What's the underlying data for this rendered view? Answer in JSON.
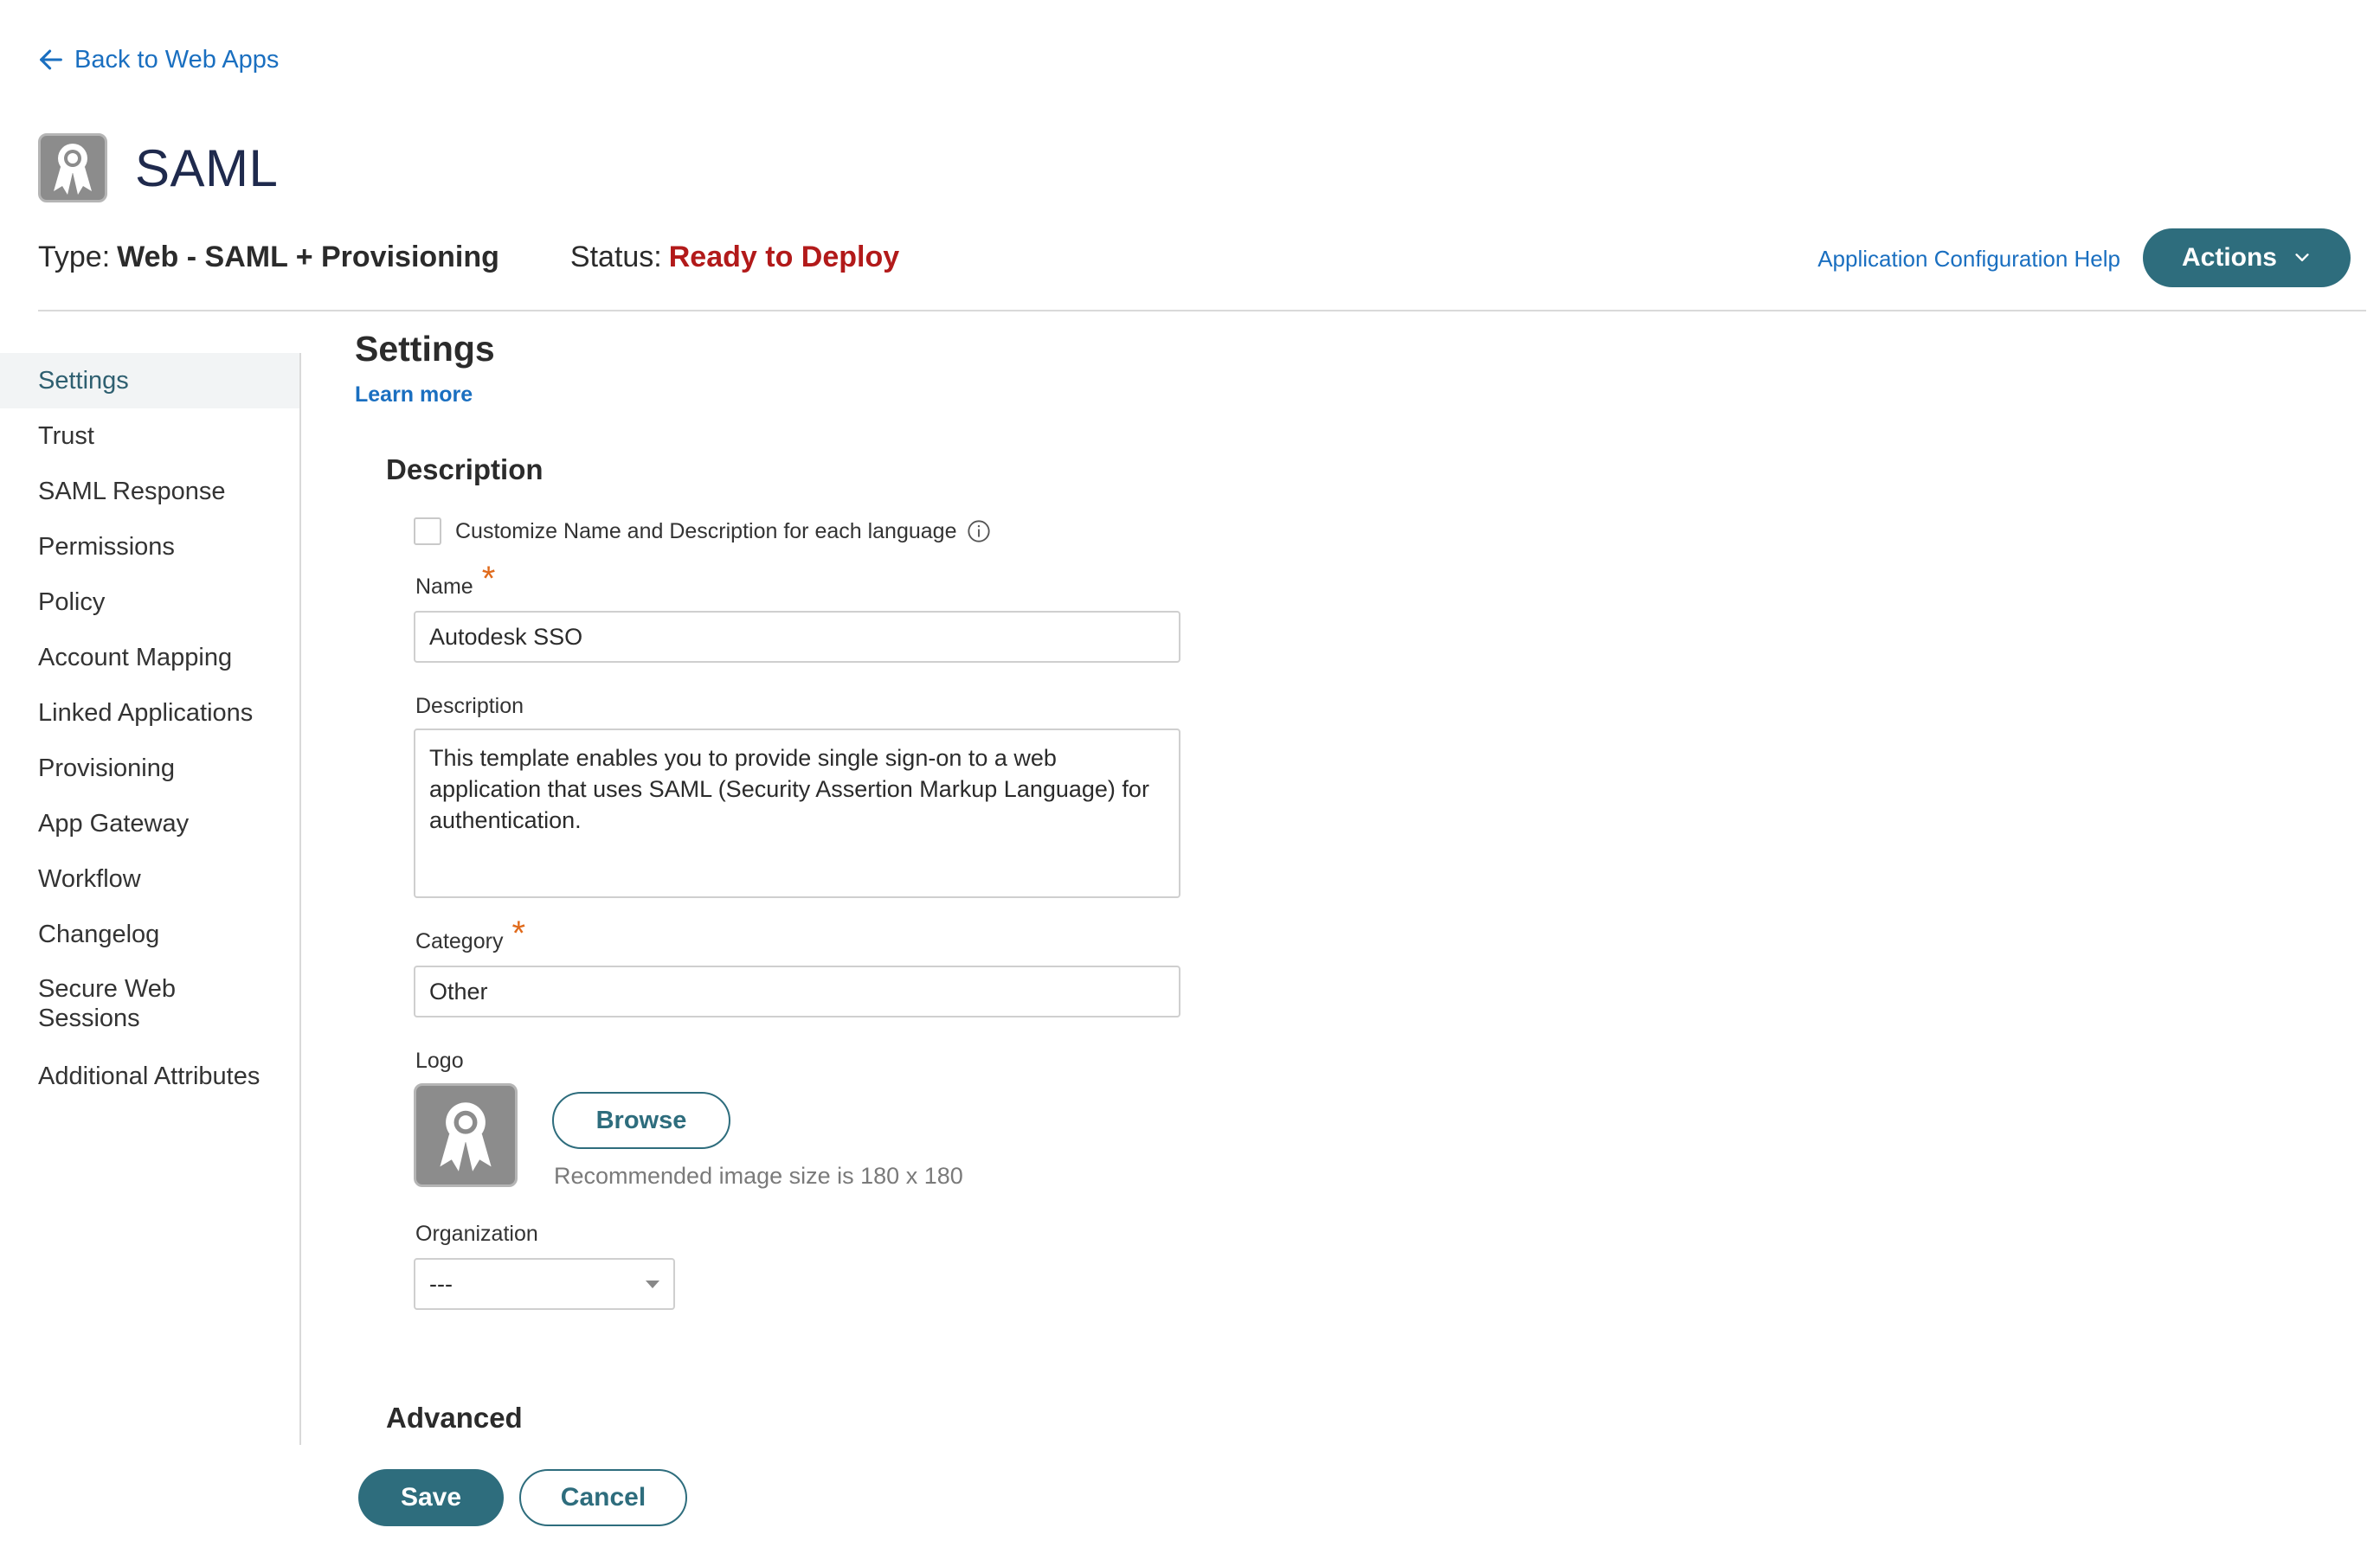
{
  "back_link": {
    "label": "Back to Web Apps",
    "icon": "arrow-left-icon"
  },
  "app": {
    "title": "SAML",
    "icon": "ribbon-badge-icon"
  },
  "meta": {
    "type_label": "Type:",
    "type_value": "Web - SAML + Provisioning",
    "status_label": "Status:",
    "status_value": "Ready to Deploy",
    "status_color": "#b21a1a"
  },
  "header_actions": {
    "help_label": "Application Configuration Help",
    "actions_label": "Actions",
    "actions_color": "#2e6d7d"
  },
  "sidebar": {
    "items": [
      {
        "label": "Settings",
        "active": true
      },
      {
        "label": "Trust"
      },
      {
        "label": "SAML Response"
      },
      {
        "label": "Permissions"
      },
      {
        "label": "Policy"
      },
      {
        "label": "Account Mapping"
      },
      {
        "label": "Linked Applications"
      },
      {
        "label": "Provisioning"
      },
      {
        "label": "App Gateway"
      },
      {
        "label": "Workflow"
      },
      {
        "label": "Changelog"
      },
      {
        "label": "Secure Web Sessions"
      },
      {
        "label": "Additional Attributes"
      }
    ]
  },
  "settings": {
    "title": "Settings",
    "learn_more": "Learn more",
    "description_heading": "Description",
    "customize_checkbox": {
      "label": "Customize Name and Description for each language",
      "checked": false
    },
    "name": {
      "label": "Name",
      "value": "Autodesk SSO",
      "required_mark": "*"
    },
    "description": {
      "label": "Description",
      "value": "This template enables you to provide single sign-on to a web application that uses SAML (Security Assertion Markup Language) for authentication."
    },
    "category": {
      "label": "Category",
      "value": "Other",
      "required_mark": "*"
    },
    "logo": {
      "label": "Logo",
      "browse_label": "Browse",
      "hint": "Recommended image size is 180 x 180"
    },
    "organization": {
      "label": "Organization",
      "value": "---"
    },
    "advanced_heading": "Advanced"
  },
  "footer": {
    "save_label": "Save",
    "cancel_label": "Cancel"
  }
}
